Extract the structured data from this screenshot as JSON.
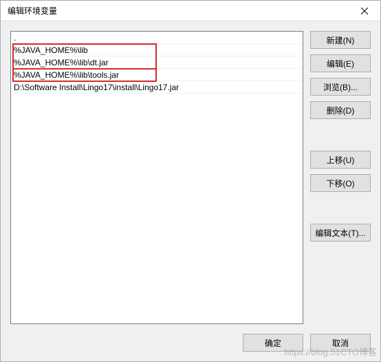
{
  "window": {
    "title": "编辑环境变量"
  },
  "list": {
    "items": [
      ".",
      "%JAVA_HOME%\\lib",
      "%JAVA_HOME%\\lib\\dt.jar",
      "%JAVA_HOME%\\lib\\tools.jar",
      "D:\\Software Install\\Lingo17\\install\\Lingo17.jar"
    ]
  },
  "buttons": {
    "new": "新建(N)",
    "edit": "编辑(E)",
    "browse": "浏览(B)...",
    "delete": "删除(D)",
    "moveup": "上移(U)",
    "movedown": "下移(O)",
    "edittext": "编辑文本(T)...",
    "ok": "确定",
    "cancel": "取消"
  },
  "watermark": "https://blog.51CTO博客"
}
